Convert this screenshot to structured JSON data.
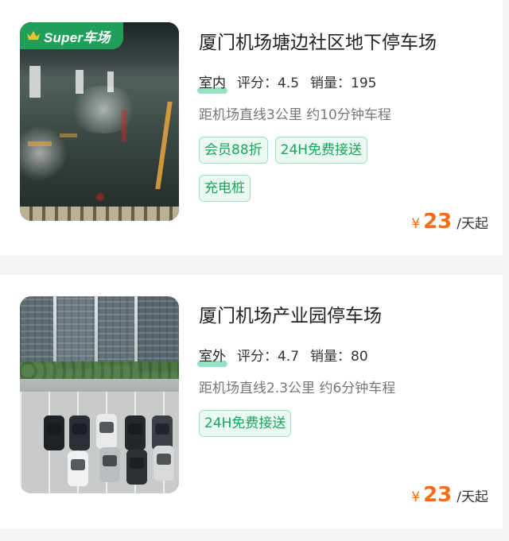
{
  "listings": [
    {
      "badge": "Super车场",
      "title": "厦门机场塘边社区地下停车场",
      "kind": "室内",
      "rating_label": "评分：",
      "rating": "4.5",
      "sales_label": "销量：",
      "sales": "195",
      "distance": "距机场直线3公里 约10分钟车程",
      "tags": [
        "会员88折",
        "24H免费接送",
        "充电桩"
      ],
      "currency": "¥",
      "price": "23",
      "price_unit": "/天起"
    },
    {
      "title": "厦门机场产业园停车场",
      "kind": "室外",
      "rating_label": "评分：",
      "rating": "4.7",
      "sales_label": "销量：",
      "sales": "80",
      "distance": "距机场直线2.3公里 约6分钟车程",
      "tags": [
        "24H免费接送"
      ],
      "currency": "¥",
      "price": "23",
      "price_unit": "/天起"
    }
  ],
  "colors": {
    "accent_green": "#1aa460",
    "tag_background": "#eafaf1",
    "price_orange": "#ff6a14",
    "badge_green": "#1f9f5a",
    "crown_gold": "#f2c230"
  },
  "icons": {
    "crown": "crown-icon"
  }
}
